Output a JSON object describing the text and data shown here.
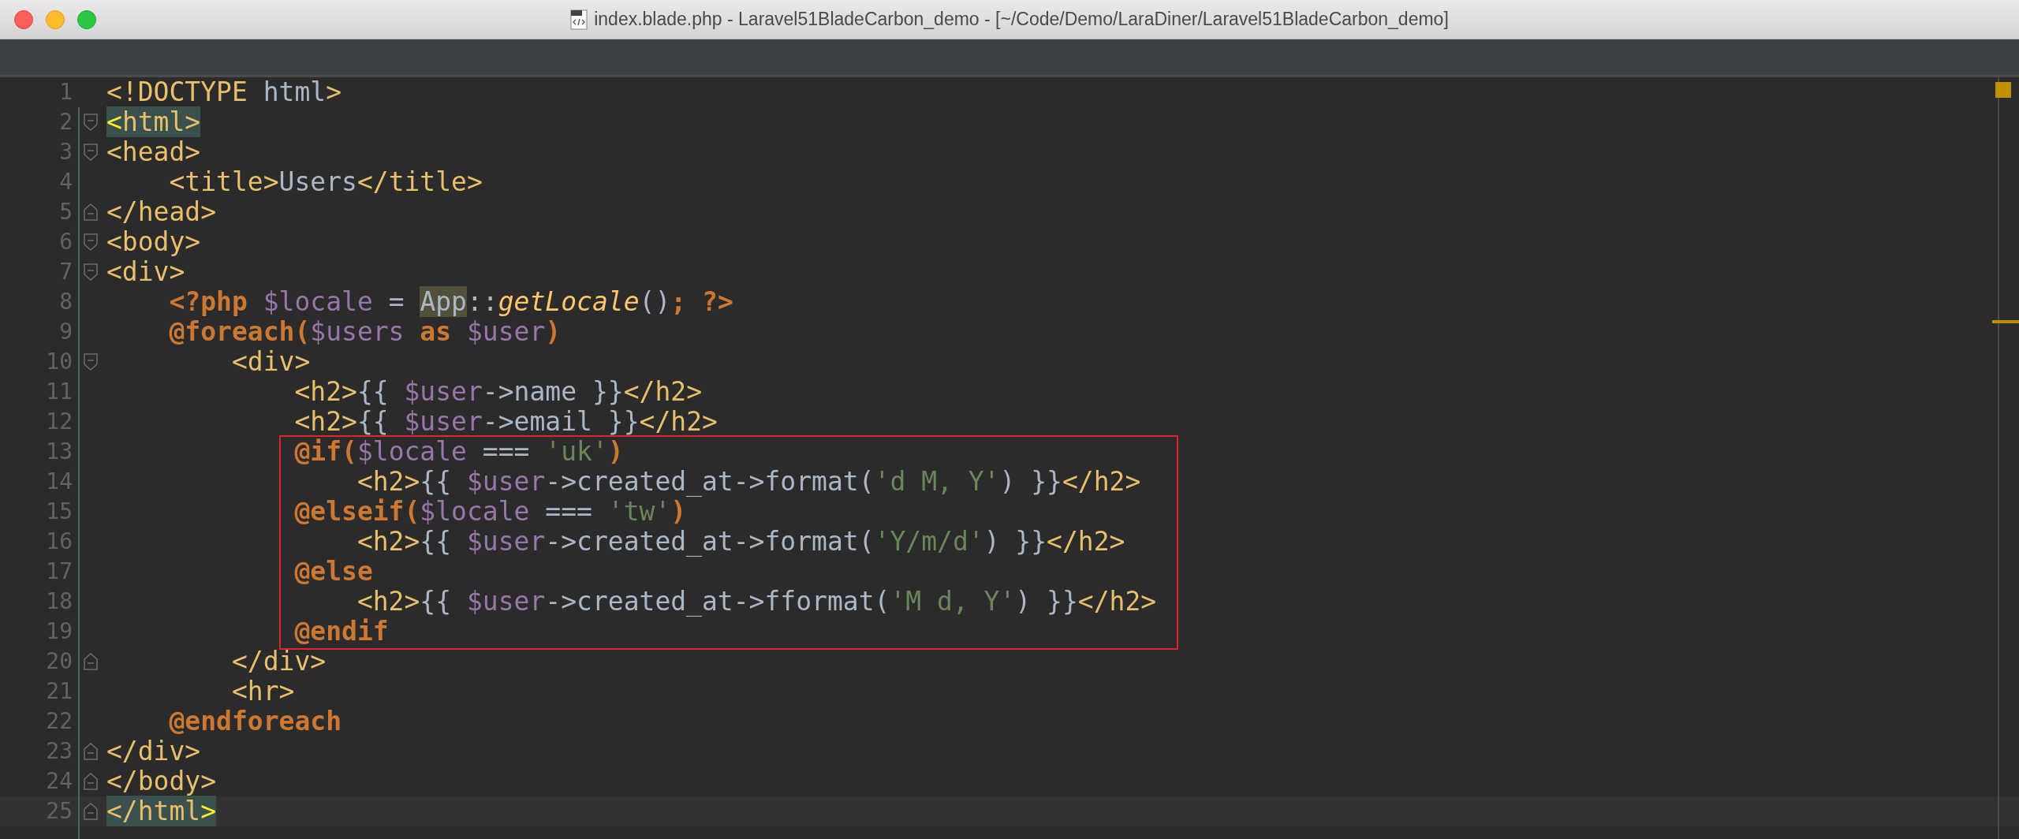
{
  "window": {
    "title": "index.blade.php - Laravel51BladeCarbon_demo - [~/Code/Demo/LaraDiner/Laravel51BladeCarbon_demo]"
  },
  "editor": {
    "blocks": [
      {
        "kind": "plain",
        "lines": [
          {
            "number": "1",
            "kind": "plain",
            "tokens": [
              {
                "kind": "tag",
                "t": "<!DOCTYPE"
              },
              {
                "kind": "text",
                "t": " html"
              },
              {
                "kind": "tag",
                "t": ">"
              }
            ]
          },
          {
            "number": "2",
            "kind": "fold-open",
            "tokens": [
              {
                "kind": "bracket-match",
                "t": "<"
              },
              {
                "kind": "tag-match",
                "t": "html>"
              }
            ]
          },
          {
            "number": "3",
            "kind": "fold-open",
            "tokens": [
              {
                "kind": "tag",
                "t": "<head>"
              }
            ]
          },
          {
            "number": "4",
            "kind": "plain",
            "tokens": [
              {
                "kind": "tag",
                "t": "    <title>"
              },
              {
                "kind": "text",
                "t": "Users"
              },
              {
                "kind": "tag",
                "t": "</title>"
              }
            ]
          },
          {
            "number": "5",
            "kind": "fold-close",
            "tokens": [
              {
                "kind": "tag",
                "t": "</head>"
              }
            ]
          },
          {
            "number": "6",
            "kind": "fold-open",
            "tokens": [
              {
                "kind": "tag",
                "t": "<body>"
              }
            ]
          },
          {
            "number": "7",
            "kind": "fold-open",
            "tokens": [
              {
                "kind": "tag",
                "t": "<div>"
              }
            ]
          },
          {
            "number": "8",
            "kind": "plain",
            "tokens": [
              {
                "kind": "php",
                "t": "    <?php"
              },
              {
                "kind": "var",
                "t": " $locale"
              },
              {
                "kind": "text",
                "t": " = "
              },
              {
                "kind": "usage-match",
                "t": "App"
              },
              {
                "kind": "text",
                "t": "::"
              },
              {
                "kind": "fn",
                "t": "getLocale"
              },
              {
                "kind": "text",
                "t": "()"
              },
              {
                "kind": "php",
                "t": "; ?>"
              }
            ]
          },
          {
            "number": "9",
            "kind": "plain",
            "tokens": [
              {
                "kind": "php",
                "t": "    @foreach("
              },
              {
                "kind": "var",
                "t": "$users"
              },
              {
                "kind": "php",
                "t": " as "
              },
              {
                "kind": "var",
                "t": "$user"
              },
              {
                "kind": "php",
                "t": ")"
              }
            ]
          },
          {
            "number": "10",
            "kind": "fold-open",
            "tokens": [
              {
                "kind": "tag",
                "t": "        <div>"
              }
            ]
          },
          {
            "number": "11",
            "kind": "plain",
            "tokens": [
              {
                "kind": "tag",
                "t": "            <h2>"
              },
              {
                "kind": "text",
                "t": "{{ "
              },
              {
                "kind": "var",
                "t": "$user"
              },
              {
                "kind": "text",
                "t": "->name }}"
              },
              {
                "kind": "tag",
                "t": "</h2>"
              }
            ]
          },
          {
            "number": "12",
            "kind": "plain",
            "tokens": [
              {
                "kind": "tag",
                "t": "            <h2>"
              },
              {
                "kind": "text",
                "t": "{{ "
              },
              {
                "kind": "var",
                "t": "$user"
              },
              {
                "kind": "text",
                "t": "->email }}"
              },
              {
                "kind": "tag",
                "t": "</h2>"
              }
            ]
          }
        ]
      },
      {
        "kind": "boxed",
        "lines": [
          {
            "number": "13",
            "kind": "plain",
            "tokens": [
              {
                "kind": "php",
                "t": "            @if("
              },
              {
                "kind": "var",
                "t": "$locale"
              },
              {
                "kind": "text",
                "t": " === "
              },
              {
                "kind": "str",
                "t": "'uk'"
              },
              {
                "kind": "php",
                "t": ")"
              }
            ]
          },
          {
            "number": "14",
            "kind": "plain",
            "tokens": [
              {
                "kind": "tag",
                "t": "                <h2>"
              },
              {
                "kind": "text",
                "t": "{{ "
              },
              {
                "kind": "var",
                "t": "$user"
              },
              {
                "kind": "text",
                "t": "->created_at->format("
              },
              {
                "kind": "str",
                "t": "'d M, Y'"
              },
              {
                "kind": "text",
                "t": ") }}"
              },
              {
                "kind": "tag",
                "t": "</h2>"
              }
            ]
          },
          {
            "number": "15",
            "kind": "plain",
            "tokens": [
              {
                "kind": "php",
                "t": "            @elseif("
              },
              {
                "kind": "var",
                "t": "$locale"
              },
              {
                "kind": "text",
                "t": " === "
              },
              {
                "kind": "str",
                "t": "'tw'"
              },
              {
                "kind": "php",
                "t": ")"
              }
            ]
          },
          {
            "number": "16",
            "kind": "plain",
            "tokens": [
              {
                "kind": "tag",
                "t": "                <h2>"
              },
              {
                "kind": "text",
                "t": "{{ "
              },
              {
                "kind": "var",
                "t": "$user"
              },
              {
                "kind": "text",
                "t": "->created_at->format("
              },
              {
                "kind": "str",
                "t": "'Y/m/d'"
              },
              {
                "kind": "text",
                "t": ") }}"
              },
              {
                "kind": "tag",
                "t": "</h2>"
              }
            ]
          },
          {
            "number": "17",
            "kind": "plain",
            "tokens": [
              {
                "kind": "php",
                "t": "            @else"
              }
            ]
          },
          {
            "number": "18",
            "kind": "plain",
            "tokens": [
              {
                "kind": "tag",
                "t": "                <h2>"
              },
              {
                "kind": "text",
                "t": "{{ "
              },
              {
                "kind": "var",
                "t": "$user"
              },
              {
                "kind": "text",
                "t": "->created_at->fformat("
              },
              {
                "kind": "str",
                "t": "'M d, Y'"
              },
              {
                "kind": "text",
                "t": ") }}"
              },
              {
                "kind": "tag",
                "t": "</h2>"
              }
            ]
          },
          {
            "number": "19",
            "kind": "plain",
            "tokens": [
              {
                "kind": "php",
                "t": "            @endif"
              }
            ]
          }
        ]
      },
      {
        "kind": "plain",
        "lines": [
          {
            "number": "20",
            "kind": "fold-close",
            "tokens": [
              {
                "kind": "tag",
                "t": "        </div>"
              }
            ]
          },
          {
            "number": "21",
            "kind": "plain",
            "tokens": [
              {
                "kind": "tag",
                "t": "        <hr>"
              }
            ]
          },
          {
            "number": "22",
            "kind": "plain",
            "tokens": [
              {
                "kind": "php",
                "t": "    @endforeach"
              }
            ]
          },
          {
            "number": "23",
            "kind": "fold-close",
            "tokens": [
              {
                "kind": "tag",
                "t": "</div>"
              }
            ]
          },
          {
            "number": "24",
            "kind": "fold-close",
            "tokens": [
              {
                "kind": "tag",
                "t": "</body>"
              }
            ]
          }
        ]
      },
      {
        "kind": "caret-line",
        "lines": [
          {
            "number": "25",
            "kind": "fold-close",
            "tokens": [
              {
                "kind": "tag-match",
                "t": "</html"
              },
              {
                "kind": "bracket-match",
                "t": ">"
              }
            ]
          }
        ]
      }
    ]
  }
}
